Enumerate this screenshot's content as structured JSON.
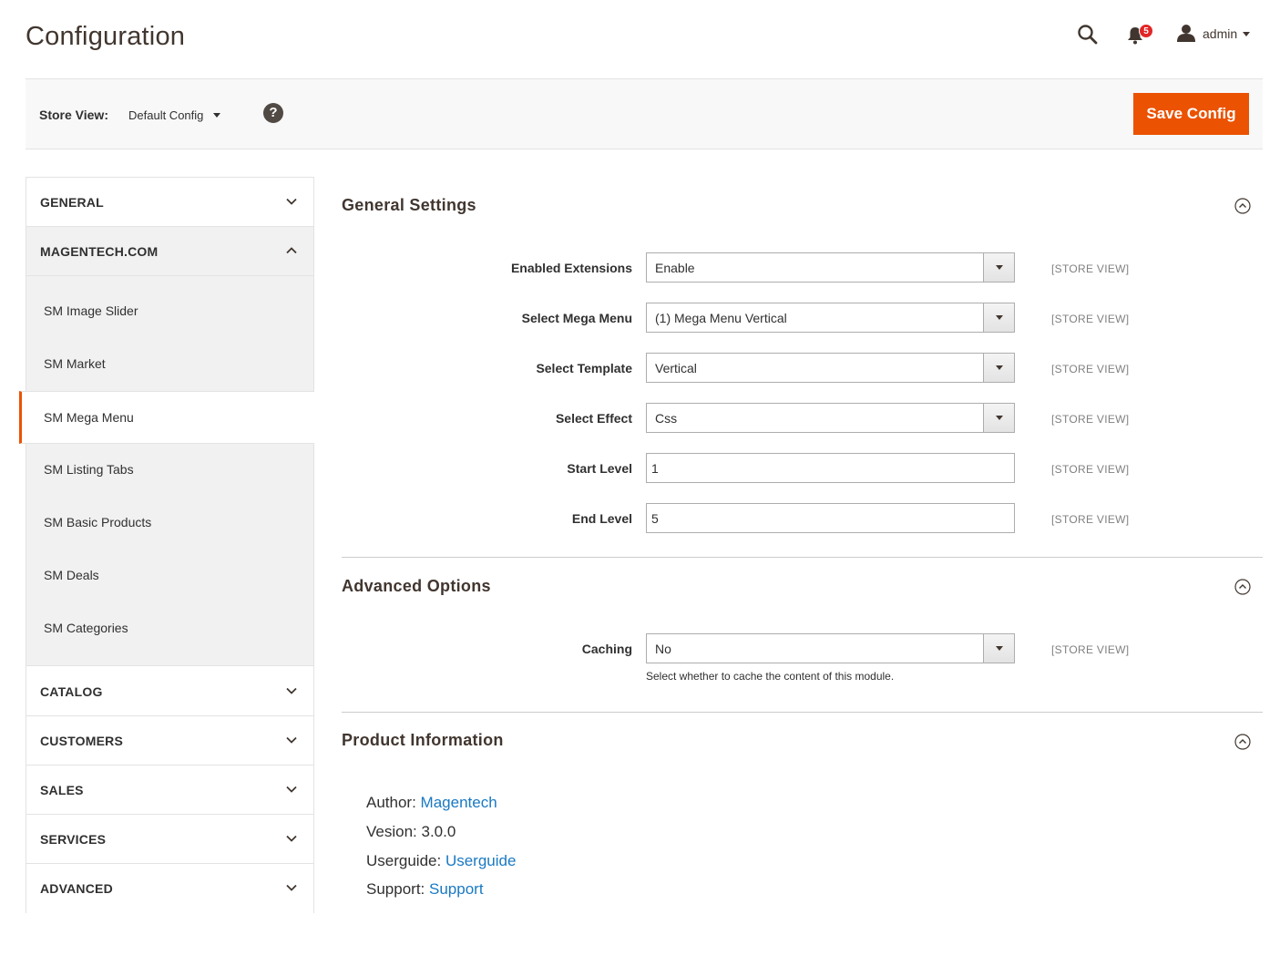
{
  "header": {
    "title": "Configuration",
    "notifications_count": "5",
    "user_name": "admin"
  },
  "store_view": {
    "label": "Store View:",
    "value": "Default Config",
    "help": "?",
    "save_label": "Save Config"
  },
  "sidebar": {
    "sections": [
      {
        "label": "GENERAL"
      },
      {
        "label": "MAGENTECH.COM"
      },
      {
        "label": "CATALOG"
      },
      {
        "label": "CUSTOMERS"
      },
      {
        "label": "SALES"
      },
      {
        "label": "SERVICES"
      },
      {
        "label": "ADVANCED"
      }
    ],
    "magentech_items": [
      {
        "label": "SM Image Slider"
      },
      {
        "label": "SM Market"
      },
      {
        "label": "SM Mega Menu"
      },
      {
        "label": "SM Listing Tabs"
      },
      {
        "label": "SM Basic Products"
      },
      {
        "label": "SM Deals"
      },
      {
        "label": "SM Categories"
      }
    ]
  },
  "general_settings": {
    "title": "General Settings",
    "fields": [
      {
        "label": "Enabled Extensions",
        "value": "Enable",
        "scope": "[STORE VIEW]"
      },
      {
        "label": "Select Mega Menu",
        "value": "(1) Mega Menu Vertical",
        "scope": "[STORE VIEW]"
      },
      {
        "label": "Select Template",
        "value": "Vertical",
        "scope": "[STORE VIEW]"
      },
      {
        "label": "Select Effect",
        "value": "Css",
        "scope": "[STORE VIEW]"
      },
      {
        "label": "Start Level",
        "value": "1",
        "scope": "[STORE VIEW]"
      },
      {
        "label": "End Level",
        "value": "5",
        "scope": "[STORE VIEW]"
      }
    ]
  },
  "advanced_options": {
    "title": "Advanced Options",
    "caching": {
      "label": "Caching",
      "value": "No",
      "scope": "[STORE VIEW]",
      "note": "Select whether to cache the content of this module."
    }
  },
  "product_information": {
    "title": "Product Information",
    "author_label": "Author:",
    "author_value": "Magentech",
    "version_label": "Vesion:",
    "version_value": "3.0.0",
    "userguide_label": "Userguide:",
    "userguide_value": "Userguide",
    "support_label": "Support:",
    "support_value": "Support"
  },
  "colors": {
    "accent": "#eb5202",
    "link": "#1979c3",
    "badge": "#e22626"
  }
}
